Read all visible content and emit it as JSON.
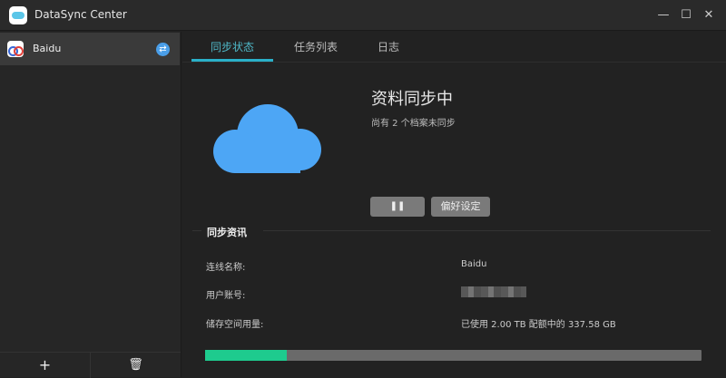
{
  "window": {
    "title": "DataSync Center",
    "minimize": "—",
    "maximize": "☐",
    "close": "✕"
  },
  "sidebar": {
    "items": [
      {
        "label": "Baidu",
        "status_icon": "sync-icon"
      }
    ],
    "add": "+",
    "delete": "🗑"
  },
  "tabs": [
    {
      "label": "同步状态",
      "active": true
    },
    {
      "label": "任务列表"
    },
    {
      "label": "日志"
    }
  ],
  "status": {
    "title": "资料同步中",
    "subtitle": "尚有 2 个档案未同步",
    "pause_label": "❚❚",
    "settings_label": "偏好设定"
  },
  "info": {
    "section_title": "同步资讯",
    "rows": [
      {
        "label": "连线名称:",
        "value": "Baidu"
      },
      {
        "label": "用户账号:",
        "value": ""
      },
      {
        "label": "储存空间用量:",
        "value": "已使用 2.00 TB 配额中的 337.58 GB"
      }
    ],
    "usage_percent": 16.5
  },
  "colors": {
    "accent": "#2ab0c8",
    "progress": "#1ecb8e",
    "cloud": "#4da6f5"
  }
}
